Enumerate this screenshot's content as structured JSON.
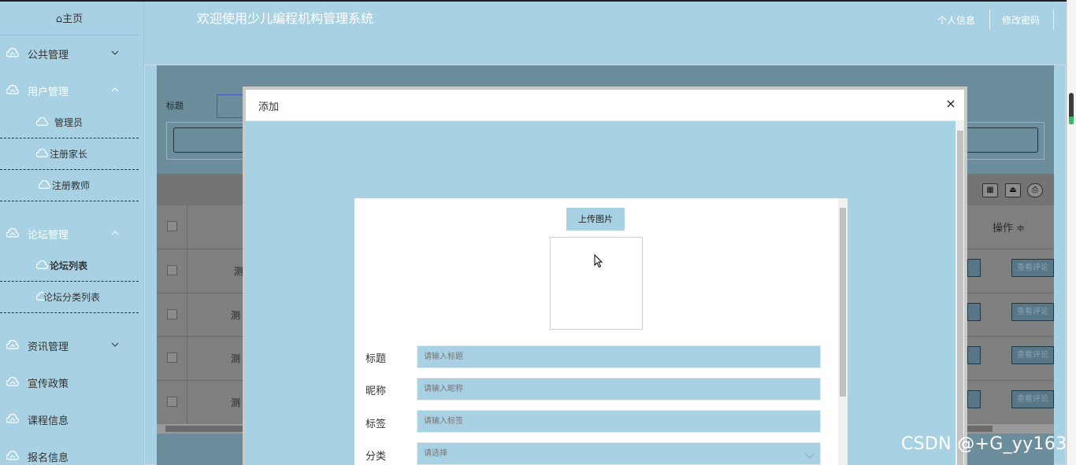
{
  "header": {
    "title": "欢迎使用少儿编程机构管理系统",
    "profile_link": "个人信息",
    "password_link": "修改密码"
  },
  "sidebar": {
    "home": "⌂主页",
    "menus": [
      {
        "label": "公共管理",
        "expanded": false
      },
      {
        "label": "用户管理",
        "expanded": true
      },
      {
        "label": "论坛管理",
        "expanded": true
      },
      {
        "label": "资讯管理",
        "expanded": false
      },
      {
        "label": "宣传政策"
      },
      {
        "label": "课程信息"
      },
      {
        "label": "报名信息"
      }
    ],
    "user_sub": [
      "管理员",
      "注册家长",
      "注册教师"
    ],
    "forum_sub": [
      "论坛列表",
      "论坛分类列表"
    ],
    "active_item": "论坛列表"
  },
  "background_page": {
    "search_label": "标题",
    "column_operation": "操作 ≑",
    "row_text": [
      "测",
      "测",
      "测",
      "测"
    ],
    "row_action": "查看评论",
    "tool_icons": [
      "grid-icon",
      "export-icon",
      "print-icon"
    ]
  },
  "modal": {
    "title": "添加",
    "close": "×",
    "upload_button": "上传图片",
    "fields": [
      {
        "label": "标题",
        "placeholder": "请输入标题"
      },
      {
        "label": "昵称",
        "placeholder": "请输入昵称"
      },
      {
        "label": "标签",
        "placeholder": "请输入标签"
      },
      {
        "label": "分类",
        "placeholder": "请选择"
      }
    ]
  },
  "watermark": "CSDN @+G_yy163",
  "colors": {
    "theme": "#a8d2e4",
    "overlay_panel": "#6c8d9c",
    "white": "#ffffff"
  }
}
